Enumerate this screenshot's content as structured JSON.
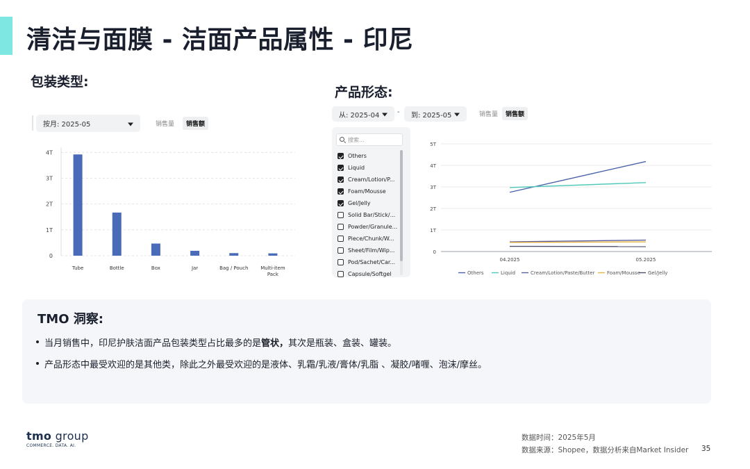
{
  "title": "清洁与面膜 - 洁面产品属性 - 印尼",
  "packaging": {
    "label": "包装类型:",
    "month_select": "按月: 2025-05",
    "toggle_volume": "销售量",
    "toggle_amount": "销售额"
  },
  "form": {
    "label": "产品形态:",
    "from_select": "从: 2025-04",
    "to_select": "到: 2025-05",
    "dash": "-",
    "toggle_volume": "销售量",
    "toggle_amount": "销售额",
    "search_placeholder": "搜索...",
    "filters": [
      {
        "label": "Others",
        "checked": true
      },
      {
        "label": "Liquid",
        "checked": true
      },
      {
        "label": "Cream/Lotion/P...",
        "checked": true
      },
      {
        "label": "Foam/Mousse",
        "checked": true
      },
      {
        "label": "Gel/Jelly",
        "checked": true
      },
      {
        "label": "Solid Bar/Stick/...",
        "checked": false
      },
      {
        "label": "Powder/Granule...",
        "checked": false
      },
      {
        "label": "Piece/Chunk/W...",
        "checked": false
      },
      {
        "label": "Sheet/Film/Wip...",
        "checked": false
      },
      {
        "label": "Pod/Sachet/Car...",
        "checked": false
      },
      {
        "label": "Capsule/Softgel",
        "checked": false
      }
    ]
  },
  "chart_data": [
    {
      "type": "bar",
      "categories": [
        "Tube",
        "Bottle",
        "Box",
        "Jar",
        "Bag / Pouch",
        "Multi-item Pack"
      ],
      "values": [
        3.92,
        1.67,
        0.47,
        0.19,
        0.1,
        0.09
      ],
      "ylim": [
        0,
        4
      ],
      "yticks": [
        "0",
        "1T",
        "2T",
        "3T",
        "4T"
      ],
      "ytick_values": [
        0,
        1,
        2,
        3,
        4
      ],
      "color": "#4a6bb8",
      "grid": true
    },
    {
      "type": "line",
      "x": [
        "04.2025",
        "05.2025"
      ],
      "ylim": [
        0,
        5
      ],
      "yticks": [
        "0",
        "1T",
        "2T",
        "3T",
        "4T",
        "5T"
      ],
      "ytick_values": [
        0,
        1,
        2,
        3,
        4,
        5
      ],
      "grid": true,
      "legend_position": "bottom",
      "series": [
        {
          "name": "Others",
          "values": [
            2.75,
            4.18
          ],
          "color": "#4a62a8"
        },
        {
          "name": "Liquid",
          "values": [
            2.97,
            3.2
          ],
          "color": "#4cc9b8"
        },
        {
          "name": "Cream/Lotion/Paste/Butter",
          "values": [
            0.45,
            0.53
          ],
          "color": "#5b5f9e"
        },
        {
          "name": "Foam/Mousse",
          "values": [
            0.42,
            0.45
          ],
          "color": "#e8b445"
        },
        {
          "name": "Gel/Jelly",
          "values": [
            0.24,
            0.23
          ],
          "color": "#4a4e6e"
        }
      ]
    }
  ],
  "insight": {
    "title": "TMO 洞察:",
    "b1_pre": "当月销售中，印尼护肤洁面产品包装类型占比最多的是",
    "b1_bold": "管状，",
    "b1_post": "其次是瓶装、盒装、罐装。",
    "b2": "产品形态中最受欢迎的是其他类，除此之外最受欢迎的是液体、乳霜/乳液/膏体/乳脂 、凝胶/啫喱、泡沫/摩丝。"
  },
  "footer": {
    "logo_main": "tmo",
    "logo_group": " group",
    "logo_tagline": "COMMERCE. DATA. AI.",
    "data_time": "数据时间：2025年5月",
    "data_source": "数据来源：Shopee，数据分析来自Market Insider",
    "page_number": "35"
  },
  "colors": {
    "accent": "#7ee7e1",
    "bar": "#4a6bb8"
  }
}
